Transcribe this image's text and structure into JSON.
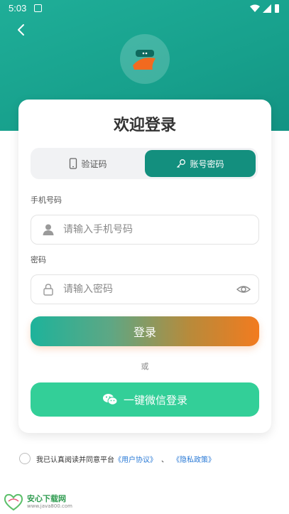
{
  "status_bar": {
    "time": "5:03"
  },
  "title": "欢迎登录",
  "tabs": [
    {
      "label": "验证码",
      "icon": "phone-icon",
      "active": false
    },
    {
      "label": "账号密码",
      "icon": "key-icon",
      "active": true
    }
  ],
  "phone": {
    "label": "手机号码",
    "placeholder": "请输入手机号码",
    "icon": "user-icon"
  },
  "password": {
    "label": "密码",
    "placeholder": "请输入密码",
    "icon": "lock-icon",
    "toggle_icon": "eye-icon"
  },
  "login_button": "登录",
  "or_text": "或",
  "wechat_button": {
    "label": "一键微信登录",
    "icon": "wechat-icon"
  },
  "agreement": {
    "text": "我已认真阅读并同意平台",
    "user_agreement": "《用户协议》",
    "separator": "、",
    "privacy_policy": "《隐私政策》"
  },
  "watermark": {
    "title": "安心下载网",
    "url": "www.java800.com"
  },
  "colors": {
    "primary": "#17a08c",
    "active_tab": "#138f7e",
    "accent_orange": "#f27b1f",
    "wechat_green": "#33cf98",
    "link": "#2a7ad6"
  }
}
